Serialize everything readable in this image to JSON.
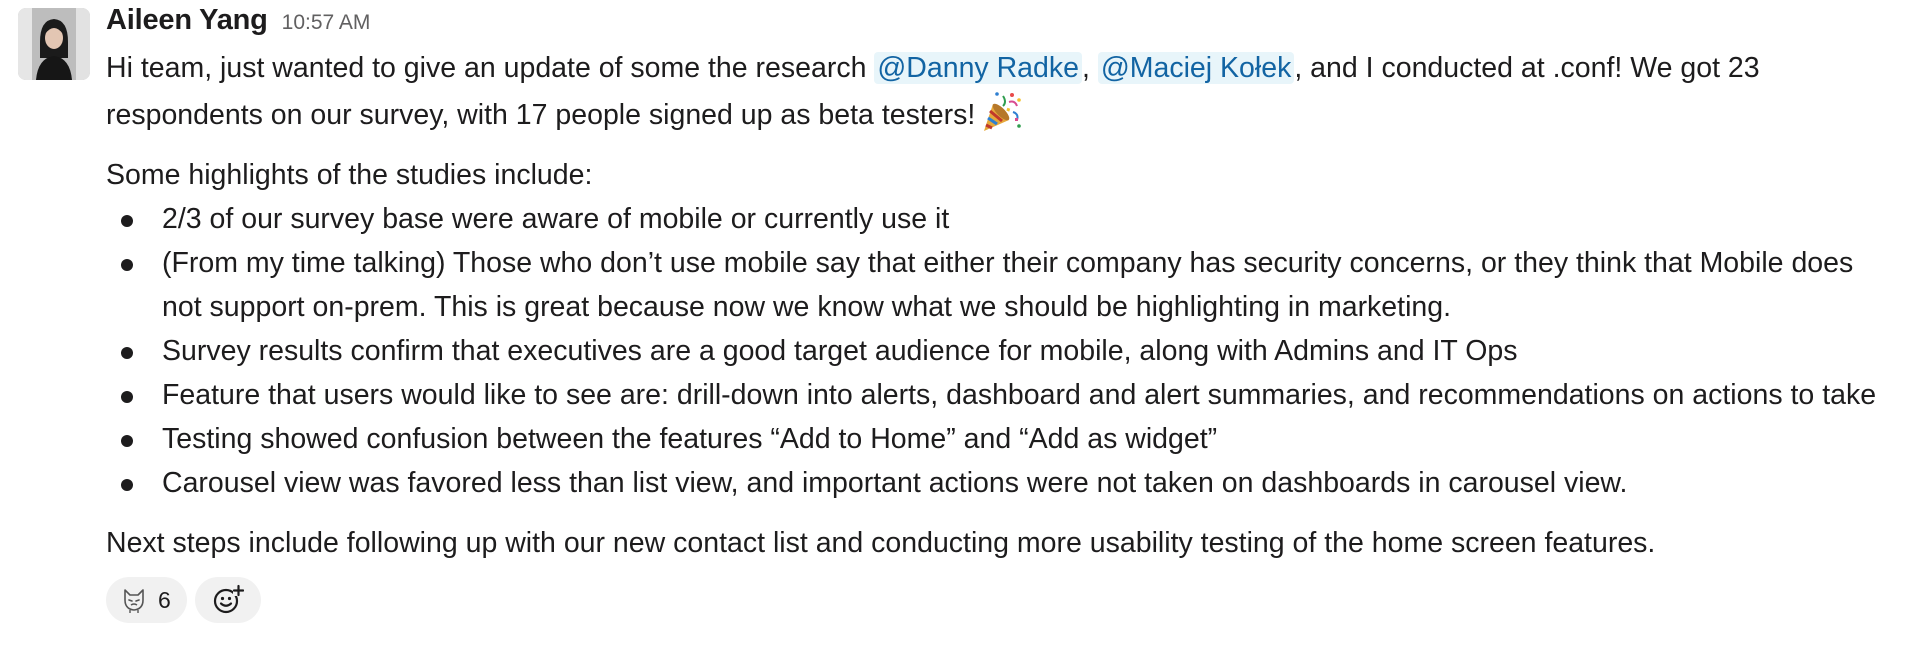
{
  "message": {
    "author": "Aileen Yang",
    "timestamp": "10:57 AM",
    "avatar_icon": "user-avatar-photo",
    "intro": {
      "before_mention1": "Hi team, just wanted to give an update of some the research ",
      "mention1": "@Danny Radke",
      "between_mentions": ", ",
      "mention2": "@Maciej Kołek",
      "after_mentions": ", and I conducted at .conf! We got 23 respondents on our survey, with 17 people signed up as beta testers!",
      "emoji": "party-popper-emoji"
    },
    "highlights_heading": "Some highlights of the studies include:",
    "bullets": [
      "2/3 of our survey base were aware of mobile or currently use it",
      "(From my time talking) Those who don’t use mobile say that either their company has security concerns, or they think that Mobile does not support on-prem. This is great because now we know what we should be highlighting in marketing.",
      "Survey results confirm that executives are a good target audience for mobile, along with Admins and IT Ops",
      "Feature that users would like to see are: drill-down into alerts, dashboard and alert summaries, and recommendations on actions to take",
      "Testing showed confusion between the features “Add to Home” and “Add as widget”",
      "Carousel view was favored less than list view, and important actions were not taken on dashboards in carousel view."
    ],
    "next_steps": "Next steps include following up with our new contact list and conducting more usability testing of the home screen features."
  },
  "reactions": [
    {
      "icon": "cat-emoji",
      "count": "6"
    }
  ],
  "add_reaction_icon": "add-emoji-reaction-icon",
  "colors": {
    "text": "#1d1c1d",
    "mention_text": "#1264a3",
    "mention_bg": "#e8f5fa",
    "timestamp": "#616061",
    "reaction_bg": "#f1f1f1"
  }
}
